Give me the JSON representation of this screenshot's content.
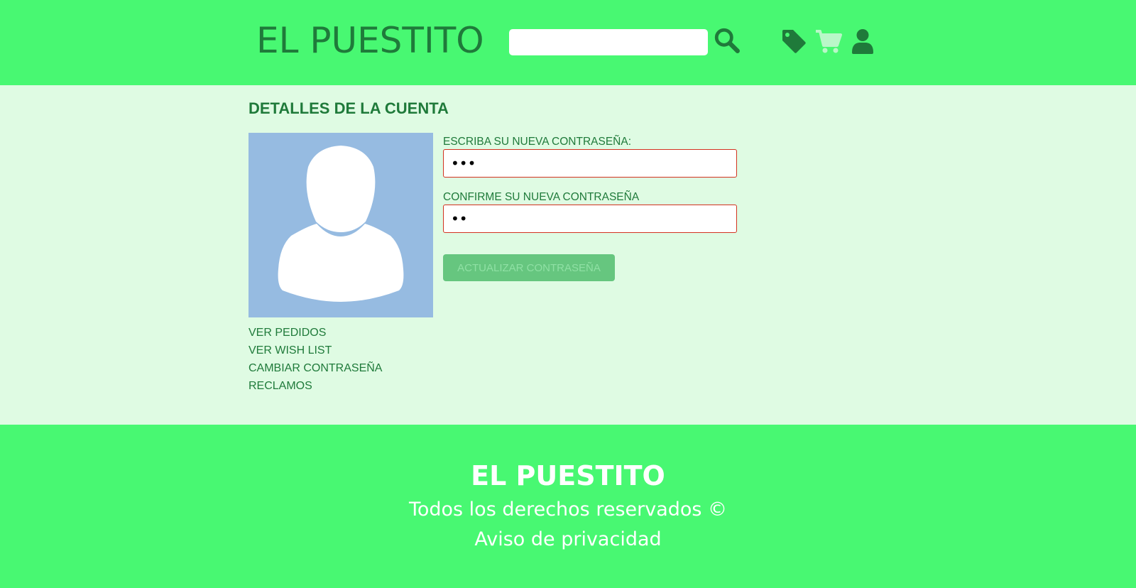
{
  "colors": {
    "header_bg": "#48f872",
    "main_bg": "#dffbe3",
    "text_dark_green": "#1f7a3a",
    "avatar_bg": "#96bbe1",
    "input_border_error": "#d2321f",
    "button_disabled_bg": "#66c67f",
    "cart_icon": "#b9f7c8"
  },
  "header": {
    "logo": "EL PUESTITO",
    "search": {
      "value": "",
      "placeholder": ""
    },
    "icons": [
      "search-icon",
      "tag-icon",
      "cart-icon",
      "user-icon"
    ]
  },
  "account": {
    "title": "DETALLES DE LA CUENTA",
    "avatar_icon": "user-silhouette-icon",
    "nav": [
      {
        "label": "VER PEDIDOS"
      },
      {
        "label": "VER WISH LIST"
      },
      {
        "label": "CAMBIAR CONTRASEÑA"
      },
      {
        "label": "RECLAMOS"
      }
    ],
    "new_password": {
      "label": "ESCRIBA SU NUEVA CONTRASEÑA:",
      "value": "•••"
    },
    "confirm_password": {
      "label": "CONFIRME SU NUEVA CONTRASEÑA",
      "value": "••"
    },
    "submit_label": "ACTUALIZAR CONTRASEÑA"
  },
  "footer": {
    "title": "EL PUESTITO",
    "rights": "Todos los derechos reservados ©",
    "privacy": "Aviso de privacidad"
  }
}
